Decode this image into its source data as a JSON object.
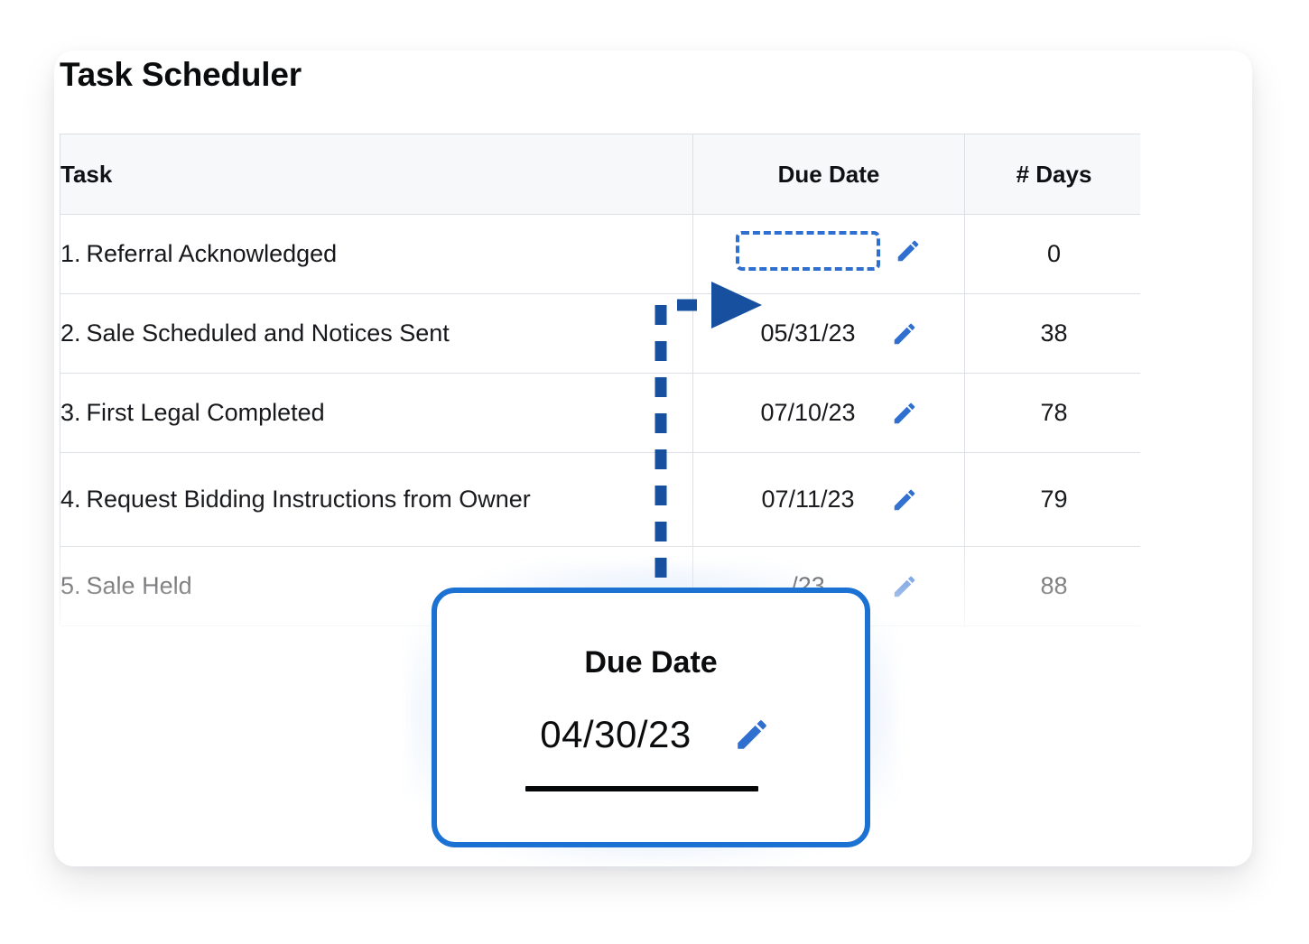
{
  "page": {
    "title": "Task Scheduler",
    "background": "#ffffff",
    "accent_blue": "#2f6fd0",
    "arrow_blue": "#16509e",
    "callout_border": "#1b72d2",
    "pencil_blue": "#2f6fd0"
  },
  "table": {
    "columns": [
      {
        "key": "task",
        "label": "Task",
        "align": "left"
      },
      {
        "key": "due_date",
        "label": "Due Date",
        "align": "center"
      },
      {
        "key": "days",
        "label": "# Days",
        "align": "center"
      }
    ],
    "rows": [
      {
        "index": "1.",
        "task": "Referral Acknowledged",
        "due_date": "",
        "due_date_empty": true,
        "days": "0",
        "edit_icon": "pencil-icon"
      },
      {
        "index": "2.",
        "task": "Sale Scheduled and Notices Sent",
        "due_date": "05/31/23",
        "due_date_empty": false,
        "days": "38",
        "edit_icon": "pencil-icon"
      },
      {
        "index": "3.",
        "task": "First Legal Completed",
        "due_date": "07/10/23",
        "due_date_empty": false,
        "days": "78",
        "edit_icon": "pencil-icon"
      },
      {
        "index": "4.",
        "task": "Request Bidding Instructions from Owner",
        "due_date": "07/11/23",
        "due_date_empty": false,
        "days": "79",
        "edit_icon": "pencil-icon"
      },
      {
        "index": "5.",
        "task": "Sale Held",
        "due_date": "/23",
        "due_date_empty": false,
        "days": "88",
        "edit_icon": "pencil-icon"
      }
    ]
  },
  "callout": {
    "title": "Due Date",
    "value": "04/30/23",
    "edit_icon": "pencil-icon"
  },
  "annotation": {
    "pointer_icon": "arrow-right-icon",
    "connector_icon": "dashed-elbow-connector",
    "target_icon": "dashed-empty-field"
  }
}
